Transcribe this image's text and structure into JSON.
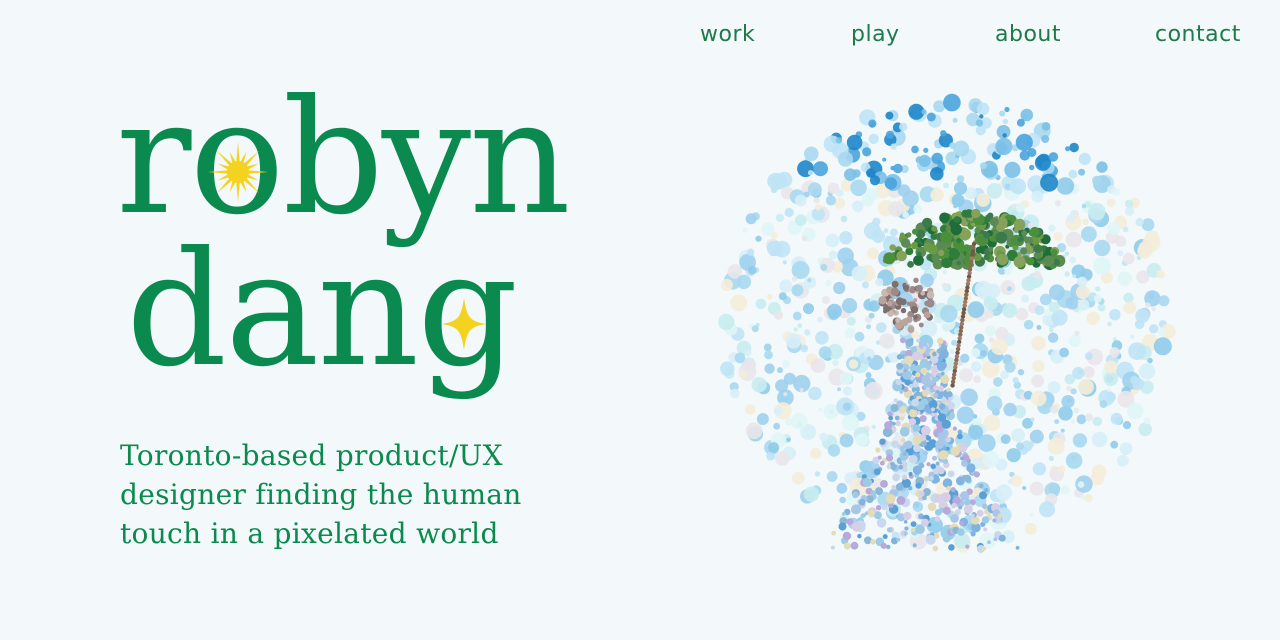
{
  "nav": {
    "items": [
      {
        "label": "work"
      },
      {
        "label": "play"
      },
      {
        "label": "about"
      },
      {
        "label": "contact"
      }
    ]
  },
  "logo": {
    "line1": "robyn",
    "line2": "dang"
  },
  "tagline": {
    "lines": [
      "Toronto-based product/UX",
      "designer finding the human",
      "touch in a pixelated world"
    ]
  },
  "artwork": {
    "subject": "pointillist-dot-illustration-woman-with-umbrella"
  },
  "icons": {
    "sun": "sun-icon",
    "sparkle": "sparkle-icon"
  },
  "colors": {
    "background": "#f3f8fa",
    "brand_green": "#0a8a4e",
    "nav_green": "#1f7a4a",
    "accent_yellow": "#f4d320"
  }
}
